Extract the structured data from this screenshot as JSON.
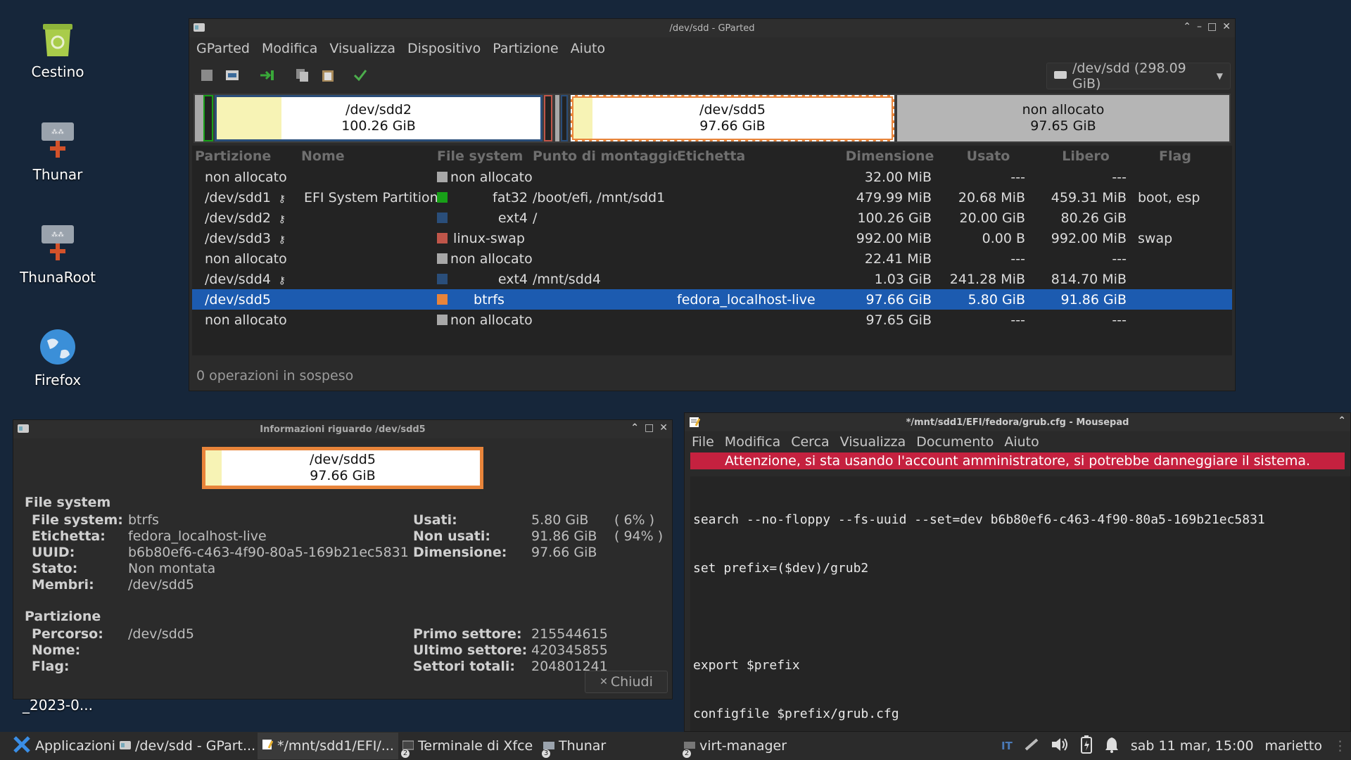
{
  "desktop": {
    "icons": [
      {
        "label": "Cestino",
        "icon": "trash-icon"
      },
      {
        "label": "Thunar",
        "icon": "network-drive-icon"
      },
      {
        "label": "ThunaRoot",
        "icon": "network-drive-icon"
      },
      {
        "label": "Firefox",
        "icon": "globe-icon"
      }
    ],
    "partial_label": "_2023-0..."
  },
  "gparted": {
    "title": "/dev/sdd - GParted",
    "menu": [
      "GParted",
      "Modifica",
      "Visualizza",
      "Dispositivo",
      "Partizione",
      "Aiuto"
    ],
    "device_selector": "/dev/sdd (298.09 GiB)",
    "map": {
      "sdd2": {
        "name": "/dev/sdd2",
        "size": "100.26 GiB"
      },
      "sdd5": {
        "name": "/dev/sdd5",
        "size": "97.66 GiB"
      },
      "unalloc": {
        "name": "non allocato",
        "size": "97.65 GiB"
      }
    },
    "columns": [
      "Partizione",
      "Nome",
      "File system",
      "Punto di montaggio",
      "Etichetta",
      "Dimensione",
      "Usato",
      "Libero",
      "Flag"
    ],
    "rows": [
      {
        "partition": "non allocato",
        "key": false,
        "name": "",
        "fs": "non allocato",
        "fs_color": "#a8a8a8",
        "fs_align": "left",
        "mount": "",
        "label": "",
        "size": "32.00 MiB",
        "used": "---",
        "free": "---",
        "flag": "",
        "selected": false
      },
      {
        "partition": "/dev/sdd1",
        "key": true,
        "name": "EFI System Partition",
        "fs": "fat32",
        "fs_color": "#18a018",
        "fs_align": "right",
        "mount": "/boot/efi, /mnt/sdd1",
        "label": "",
        "size": "479.99 MiB",
        "used": "20.68 MiB",
        "free": "459.31 MiB",
        "flag": "boot, esp",
        "selected": false
      },
      {
        "partition": "/dev/sdd2",
        "key": true,
        "name": "",
        "fs": "ext4",
        "fs_color": "#2a4e7a",
        "fs_align": "right",
        "mount": "/",
        "label": "",
        "size": "100.26 GiB",
        "used": "20.00 GiB",
        "free": "80.26 GiB",
        "flag": "",
        "selected": false
      },
      {
        "partition": "/dev/sdd3",
        "key": true,
        "name": "",
        "fs": "linux-swap",
        "fs_color": "#c0564a",
        "fs_align": "center",
        "mount": "",
        "label": "",
        "size": "992.00 MiB",
        "used": "0.00 B",
        "free": "992.00 MiB",
        "flag": "swap",
        "selected": false
      },
      {
        "partition": "non allocato",
        "key": false,
        "name": "",
        "fs": "non allocato",
        "fs_color": "#a8a8a8",
        "fs_align": "left",
        "mount": "",
        "label": "",
        "size": "22.41 MiB",
        "used": "---",
        "free": "---",
        "flag": "",
        "selected": false
      },
      {
        "partition": "/dev/sdd4",
        "key": true,
        "name": "",
        "fs": "ext4",
        "fs_color": "#2a4e7a",
        "fs_align": "right",
        "mount": "/mnt/sdd4",
        "label": "",
        "size": "1.03 GiB",
        "used": "241.28 MiB",
        "free": "814.70 MiB",
        "flag": "",
        "selected": false
      },
      {
        "partition": "/dev/sdd5",
        "key": false,
        "name": "",
        "fs": "btrfs",
        "fs_color": "#e8843a",
        "fs_align": "center",
        "mount": "",
        "label": "fedora_localhost-live",
        "size": "97.66 GiB",
        "used": "5.80 GiB",
        "free": "91.86 GiB",
        "flag": "",
        "selected": true
      },
      {
        "partition": "non allocato",
        "key": false,
        "name": "",
        "fs": "non allocato",
        "fs_color": "#a8a8a8",
        "fs_align": "left",
        "mount": "",
        "label": "",
        "size": "97.65 GiB",
        "used": "---",
        "free": "---",
        "flag": "",
        "selected": false
      }
    ],
    "status": "0 operazioni in sospeso"
  },
  "info": {
    "title": "Informazioni riguardo /dev/sdd5",
    "map_name": "/dev/sdd5",
    "map_size": "97.66 GiB",
    "fs_heading": "File system",
    "fs_left": [
      {
        "k": "File system:",
        "v": "btrfs"
      },
      {
        "k": "Etichetta:",
        "v": "fedora_localhost-live"
      },
      {
        "k": "UUID:",
        "v": "b6b80ef6-c463-4f90-80a5-169b21ec5831"
      },
      {
        "k": "Stato:",
        "v": "Non montata"
      },
      {
        "k": "Membri:",
        "v": "/dev/sdd5"
      }
    ],
    "fs_right": [
      {
        "k": "Usati:",
        "v": "5.80 GiB",
        "p": "( 6% )"
      },
      {
        "k": "Non usati:",
        "v": "91.86 GiB",
        "p": "( 94% )"
      },
      {
        "k": "Dimensione:",
        "v": "97.66 GiB",
        "p": ""
      }
    ],
    "part_heading": "Partizione",
    "part_left": [
      {
        "k": "Percorso:",
        "v": "/dev/sdd5"
      },
      {
        "k": "Nome:",
        "v": ""
      },
      {
        "k": "Flag:",
        "v": ""
      }
    ],
    "part_right": [
      {
        "k": "Primo settore:",
        "v": "215544615"
      },
      {
        "k": "Ultimo settore:",
        "v": "420345855"
      },
      {
        "k": "Settori totali:",
        "v": "204801241"
      }
    ],
    "close": "Chiudi"
  },
  "mousepad": {
    "title": "*/mnt/sdd1/EFI/fedora/grub.cfg - Mousepad",
    "menu": [
      "File",
      "Modifica",
      "Cerca",
      "Visualizza",
      "Documento",
      "Aiuto"
    ],
    "warning": "Attenzione, si sta usando l'account amministratore, si potrebbe danneggiare il sistema.",
    "lines": [
      "search --no-floppy --fs-uuid --set=dev b6b80ef6-c463-4f90-80a5-169b21ec5831",
      "set prefix=($dev)/grub2",
      "",
      "export $prefix",
      "configfile $prefix/grub.cfg",
      "|"
    ]
  },
  "taskbar": {
    "apps_label": "Applicazioni",
    "tasks": [
      {
        "label": "/dev/sdd - GPart...",
        "num": "",
        "active": false
      },
      {
        "label": "*/mnt/sdd1/EFI/...",
        "num": "",
        "active": true
      },
      {
        "label": "Terminale di Xfce",
        "num": "2",
        "active": false
      },
      {
        "label": "Thunar",
        "num": "3",
        "active": false
      },
      {
        "label": "virt-manager",
        "num": "2",
        "active": false
      }
    ],
    "kb_layout": "IT",
    "clock": "sab 11 mar, 15:00",
    "user": "marietto"
  }
}
